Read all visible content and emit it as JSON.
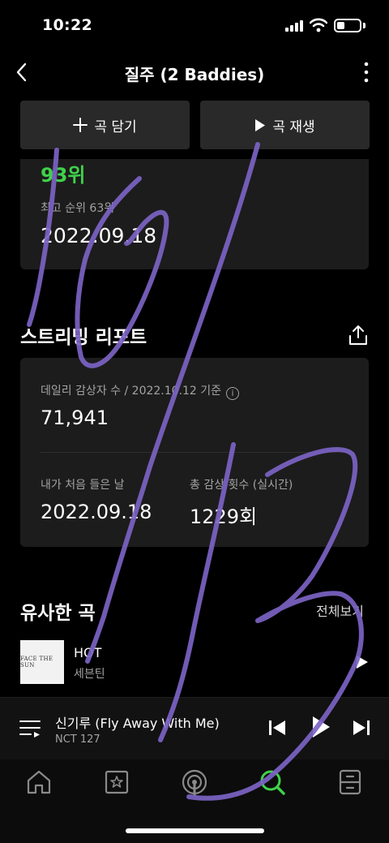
{
  "status_bar": {
    "time": "10:22"
  },
  "header": {
    "title": "질주 (2 Baddies)"
  },
  "actions": {
    "add_label": "곡 담기",
    "play_label": "곡 재생"
  },
  "chart_rank": {
    "current_rank": "93위",
    "peak_rank_label": "최고 순위 63위",
    "peak_date": "2022.09.18"
  },
  "streaming_report": {
    "title": "스트리밍 리포트",
    "daily_listeners_label": "데일리 감상자 수 / 2022.10.12 기준",
    "daily_listeners_value": "71,941",
    "first_listen_label": "내가 처음 들은 날",
    "first_listen_value": "2022.09.18",
    "total_plays_label": "총 감상 횟수 (실시간)",
    "total_plays_value": "1229회"
  },
  "similar_songs": {
    "title": "유사한 곡",
    "see_all_label": "전체보기",
    "items": [
      {
        "title": "HOT",
        "artist": "세븐틴",
        "album_art_text": "FACE THE SUN"
      }
    ]
  },
  "now_playing": {
    "title": "신기루 (Fly Away With Me)",
    "artist": "NCT 127"
  },
  "tabs": [
    {
      "icon": "home-icon",
      "active": false
    },
    {
      "icon": "library-icon",
      "active": false
    },
    {
      "icon": "podcast-icon",
      "active": false
    },
    {
      "icon": "search-icon",
      "active": true
    },
    {
      "icon": "storage-icon",
      "active": false
    }
  ],
  "colors": {
    "accent": "#3fd24b",
    "background": "#000000",
    "card": "#1c1c1c",
    "button": "#292929",
    "scribble": "#7b63c4"
  },
  "overlay": {
    "handwritten_annotation": "10/13"
  }
}
